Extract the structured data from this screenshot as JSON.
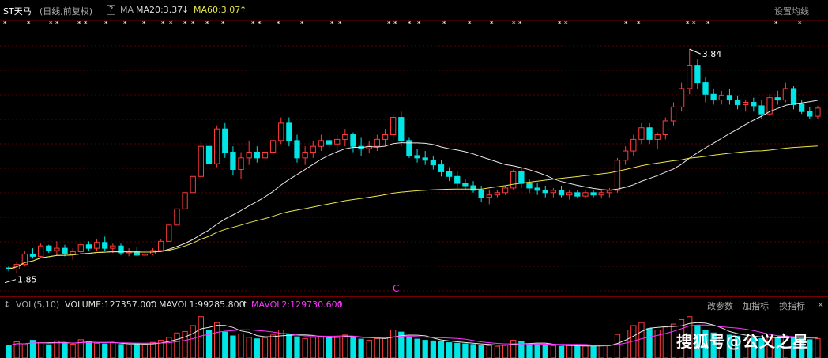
{
  "header": {
    "stock_name": "ST天马",
    "period": "(日线,前复权)",
    "help_label": "?",
    "ma_label": "MA",
    "ma20": "MA20:3.37",
    "ma60": "MA60:3.07",
    "settings_label": "设置均线",
    "arrow_down": "↓",
    "arrow_up": "↑"
  },
  "volume_panel": {
    "icon": "↕",
    "title": "VOL(5,10)",
    "volume": "VOLUME:127357.000",
    "mavol1": "MAVOL1:99285.800",
    "mavol2": "MAVOL2:129730.600",
    "arrow_up": "↑",
    "buttons": [
      "改参数",
      "加指标",
      "换指标"
    ],
    "close_icon": "×"
  },
  "annotations": {
    "high_label": "3.84",
    "low_label": "1.85",
    "c_marker": "C"
  },
  "watermark": "搜狐号@公义之星",
  "colors": {
    "up": "#ff3b3b",
    "down": "#00e5e5",
    "ma20": "#e8e8e8",
    "ma60": "#e8e84a",
    "mavol1": "#e8e8e8",
    "mavol2": "#ff33ff",
    "grid": "#5a0000"
  },
  "chart_data": {
    "type": "candlestick",
    "y_range": [
      1.8,
      3.95
    ],
    "grid": "horizontal dashed",
    "high_marker": 3.84,
    "low_marker": 1.85,
    "candles": [
      [
        1.95,
        1.97,
        1.92,
        1.94
      ],
      [
        1.94,
        2.0,
        1.9,
        1.98
      ],
      [
        1.98,
        2.1,
        1.97,
        2.07
      ],
      [
        2.07,
        2.12,
        2.03,
        2.05
      ],
      [
        2.05,
        2.16,
        2.04,
        2.14
      ],
      [
        2.14,
        2.15,
        2.08,
        2.1
      ],
      [
        2.1,
        2.18,
        2.06,
        2.12
      ],
      [
        2.12,
        2.15,
        2.05,
        2.07
      ],
      [
        2.07,
        2.12,
        2.02,
        2.09
      ],
      [
        2.09,
        2.17,
        2.07,
        2.15
      ],
      [
        2.15,
        2.18,
        2.1,
        2.12
      ],
      [
        2.12,
        2.2,
        2.1,
        2.17
      ],
      [
        2.17,
        2.22,
        2.1,
        2.12
      ],
      [
        2.12,
        2.16,
        2.08,
        2.14
      ],
      [
        2.14,
        2.16,
        2.06,
        2.08
      ],
      [
        2.08,
        2.12,
        2.05,
        2.09
      ],
      [
        2.09,
        2.13,
        2.05,
        2.06
      ],
      [
        2.06,
        2.1,
        2.04,
        2.07
      ],
      [
        2.07,
        2.12,
        2.06,
        2.1
      ],
      [
        2.1,
        2.2,
        2.09,
        2.18
      ],
      [
        2.18,
        2.32,
        2.18,
        2.32
      ],
      [
        2.32,
        2.46,
        2.32,
        2.46
      ],
      [
        2.46,
        2.6,
        2.46,
        2.6
      ],
      [
        2.6,
        2.74,
        2.6,
        2.74
      ],
      [
        2.74,
        3.05,
        2.72,
        3.0
      ],
      [
        3.0,
        3.1,
        2.8,
        2.85
      ],
      [
        2.85,
        3.18,
        2.82,
        3.15
      ],
      [
        3.15,
        3.2,
        2.9,
        2.95
      ],
      [
        2.95,
        3.0,
        2.75,
        2.8
      ],
      [
        2.8,
        2.95,
        2.72,
        2.9
      ],
      [
        2.9,
        3.05,
        2.84,
        2.95
      ],
      [
        2.95,
        3.0,
        2.86,
        2.9
      ],
      [
        2.9,
        3.0,
        2.82,
        2.95
      ],
      [
        2.95,
        3.1,
        2.92,
        3.05
      ],
      [
        3.05,
        3.25,
        3.02,
        3.2
      ],
      [
        3.2,
        3.25,
        3.0,
        3.05
      ],
      [
        3.05,
        3.1,
        2.86,
        2.9
      ],
      [
        2.9,
        3.0,
        2.84,
        2.95
      ],
      [
        2.95,
        3.05,
        2.9,
        3.0
      ],
      [
        3.0,
        3.1,
        2.96,
        3.05
      ],
      [
        3.05,
        3.12,
        2.98,
        3.02
      ],
      [
        3.02,
        3.1,
        2.96,
        3.06
      ],
      [
        3.06,
        3.15,
        3.0,
        3.1
      ],
      [
        3.1,
        3.12,
        2.95,
        3.0
      ],
      [
        3.0,
        3.08,
        2.92,
        2.98
      ],
      [
        2.98,
        3.05,
        2.94,
        3.0
      ],
      [
        3.0,
        3.1,
        2.96,
        3.06
      ],
      [
        3.06,
        3.15,
        3.0,
        3.1
      ],
      [
        3.1,
        3.28,
        3.06,
        3.25
      ],
      [
        3.25,
        3.3,
        3.0,
        3.05
      ],
      [
        3.05,
        3.08,
        2.9,
        2.92
      ],
      [
        2.92,
        2.98,
        2.86,
        2.9
      ],
      [
        2.9,
        2.96,
        2.84,
        2.88
      ],
      [
        2.88,
        2.92,
        2.8,
        2.84
      ],
      [
        2.84,
        2.88,
        2.74,
        2.78
      ],
      [
        2.78,
        2.82,
        2.7,
        2.74
      ],
      [
        2.74,
        2.78,
        2.64,
        2.68
      ],
      [
        2.68,
        2.72,
        2.62,
        2.66
      ],
      [
        2.66,
        2.7,
        2.6,
        2.62
      ],
      [
        2.62,
        2.66,
        2.52,
        2.56
      ],
      [
        2.56,
        2.62,
        2.5,
        2.58
      ],
      [
        2.58,
        2.62,
        2.56,
        2.6
      ],
      [
        2.6,
        2.66,
        2.58,
        2.64
      ],
      [
        2.64,
        2.8,
        2.62,
        2.78
      ],
      [
        2.78,
        2.82,
        2.64,
        2.68
      ],
      [
        2.68,
        2.72,
        2.6,
        2.64
      ],
      [
        2.64,
        2.68,
        2.58,
        2.62
      ],
      [
        2.62,
        2.66,
        2.56,
        2.6
      ],
      [
        2.6,
        2.64,
        2.56,
        2.62
      ],
      [
        2.62,
        2.66,
        2.56,
        2.58
      ],
      [
        2.58,
        2.62,
        2.54,
        2.6
      ],
      [
        2.6,
        2.62,
        2.55,
        2.57
      ],
      [
        2.57,
        2.62,
        2.55,
        2.6
      ],
      [
        2.6,
        2.62,
        2.56,
        2.58
      ],
      [
        2.58,
        2.62,
        2.55,
        2.6
      ],
      [
        2.6,
        2.64,
        2.56,
        2.62
      ],
      [
        2.62,
        2.9,
        2.6,
        2.88
      ],
      [
        2.88,
        3.0,
        2.84,
        2.96
      ],
      [
        2.96,
        3.1,
        2.92,
        3.06
      ],
      [
        3.06,
        3.2,
        3.02,
        3.16
      ],
      [
        3.16,
        3.2,
        3.02,
        3.06
      ],
      [
        3.06,
        3.12,
        2.98,
        3.1
      ],
      [
        3.1,
        3.25,
        3.06,
        3.22
      ],
      [
        3.22,
        3.38,
        3.18,
        3.34
      ],
      [
        3.34,
        3.55,
        3.3,
        3.5
      ],
      [
        3.5,
        3.84,
        3.45,
        3.7
      ],
      [
        3.7,
        3.75,
        3.5,
        3.55
      ],
      [
        3.55,
        3.6,
        3.38,
        3.45
      ],
      [
        3.45,
        3.5,
        3.36,
        3.4
      ],
      [
        3.4,
        3.48,
        3.36,
        3.44
      ],
      [
        3.44,
        3.5,
        3.36,
        3.4
      ],
      [
        3.4,
        3.44,
        3.32,
        3.36
      ],
      [
        3.36,
        3.4,
        3.3,
        3.38
      ],
      [
        3.38,
        3.42,
        3.3,
        3.35
      ],
      [
        3.35,
        3.4,
        3.24,
        3.28
      ],
      [
        3.28,
        3.45,
        3.26,
        3.42
      ],
      [
        3.42,
        3.48,
        3.36,
        3.4
      ],
      [
        3.4,
        3.55,
        3.38,
        3.5
      ],
      [
        3.5,
        3.52,
        3.32,
        3.36
      ],
      [
        3.36,
        3.4,
        3.28,
        3.3
      ],
      [
        3.3,
        3.34,
        3.24,
        3.26
      ],
      [
        3.26,
        3.35,
        3.24,
        3.33
      ]
    ],
    "volume": [
      42,
      55,
      48,
      60,
      52,
      45,
      58,
      50,
      47,
      62,
      55,
      50,
      48,
      52,
      46,
      44,
      50,
      47,
      53,
      60,
      70,
      85,
      90,
      110,
      140,
      95,
      120,
      88,
      75,
      82,
      70,
      65,
      68,
      78,
      95,
      80,
      72,
      66,
      70,
      74,
      68,
      72,
      78,
      70,
      64,
      60,
      66,
      70,
      95,
      88,
      70,
      64,
      60,
      58,
      55,
      52,
      50,
      48,
      46,
      44,
      42,
      40,
      44,
      60,
      55,
      48,
      46,
      44,
      42,
      40,
      42,
      40,
      41,
      40,
      42,
      44,
      80,
      95,
      110,
      120,
      100,
      95,
      105,
      115,
      130,
      140,
      110,
      95,
      85,
      82,
      78,
      74,
      70,
      68,
      66,
      72,
      68,
      75,
      70,
      65,
      62,
      66
    ],
    "vol_range": [
      0,
      150
    ]
  }
}
